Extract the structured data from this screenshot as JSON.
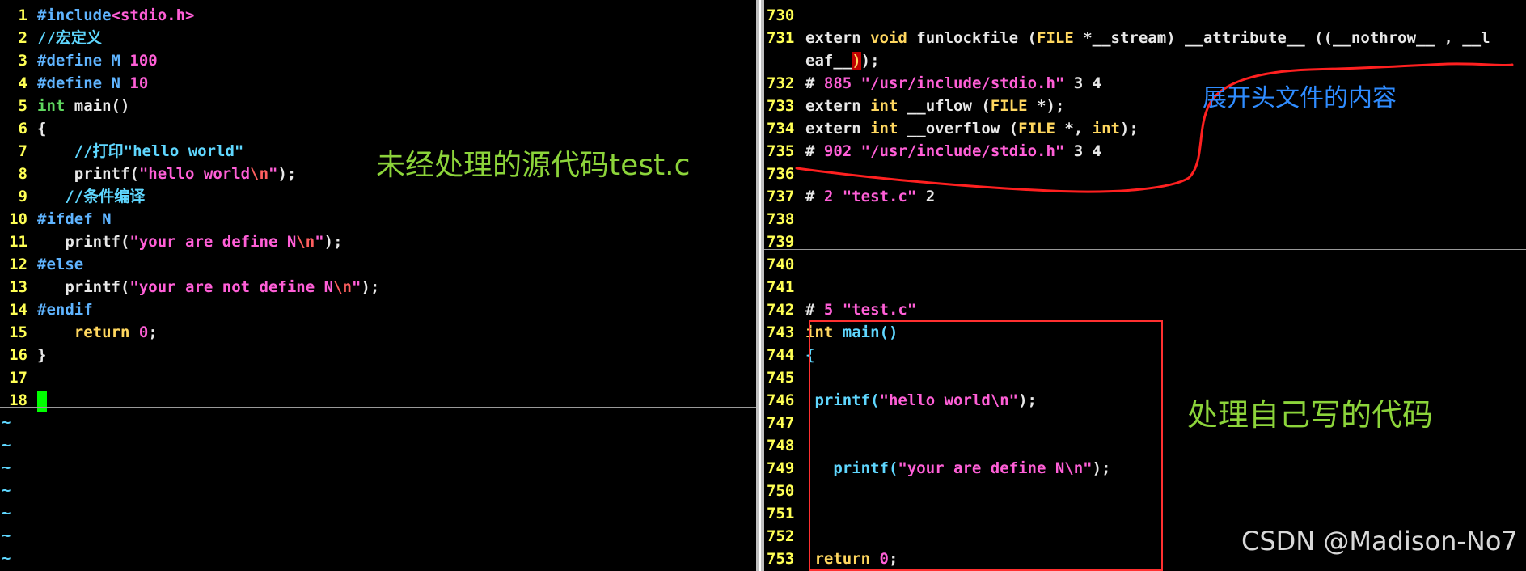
{
  "left_editor": {
    "lines": [
      {
        "n": "1",
        "parts": [
          {
            "t": "#include",
            "c": "t-pp"
          },
          {
            "t": "<stdio.h>",
            "c": "t-inc"
          }
        ]
      },
      {
        "n": "2",
        "parts": [
          {
            "t": "//宏定义",
            "c": "t-cm"
          }
        ]
      },
      {
        "n": "3",
        "parts": [
          {
            "t": "#define M ",
            "c": "t-pp"
          },
          {
            "t": "100",
            "c": "t-num"
          }
        ]
      },
      {
        "n": "4",
        "parts": [
          {
            "t": "#define N ",
            "c": "t-pp"
          },
          {
            "t": "10",
            "c": "t-num"
          }
        ]
      },
      {
        "n": "5",
        "parts": [
          {
            "t": "int",
            "c": "t-kw2"
          },
          {
            "t": " main()",
            "c": "t-plain"
          }
        ]
      },
      {
        "n": "6",
        "parts": [
          {
            "t": "{",
            "c": "t-plain"
          }
        ]
      },
      {
        "n": "7",
        "parts": [
          {
            "t": "    //打印\"hello world\"",
            "c": "t-cm"
          }
        ]
      },
      {
        "n": "8",
        "parts": [
          {
            "t": "    printf(",
            "c": "t-plain"
          },
          {
            "t": "\"hello world",
            "c": "t-str"
          },
          {
            "t": "\\n",
            "c": "t-esc"
          },
          {
            "t": "\"",
            "c": "t-str"
          },
          {
            "t": ");",
            "c": "t-plain"
          }
        ]
      },
      {
        "n": "9",
        "parts": [
          {
            "t": "   //条件编译",
            "c": "t-cm"
          }
        ]
      },
      {
        "n": "10",
        "parts": [
          {
            "t": "#ifdef N",
            "c": "t-pp"
          }
        ]
      },
      {
        "n": "11",
        "parts": [
          {
            "t": "   printf(",
            "c": "t-plain"
          },
          {
            "t": "\"your are define N",
            "c": "t-str"
          },
          {
            "t": "\\n",
            "c": "t-esc"
          },
          {
            "t": "\"",
            "c": "t-str"
          },
          {
            "t": ");",
            "c": "t-plain"
          }
        ]
      },
      {
        "n": "12",
        "parts": [
          {
            "t": "#else",
            "c": "t-pp"
          }
        ]
      },
      {
        "n": "13",
        "parts": [
          {
            "t": "   printf(",
            "c": "t-plain"
          },
          {
            "t": "\"your are not define N",
            "c": "t-str"
          },
          {
            "t": "\\n",
            "c": "t-esc"
          },
          {
            "t": "\"",
            "c": "t-str"
          },
          {
            "t": ");",
            "c": "t-plain"
          }
        ]
      },
      {
        "n": "14",
        "parts": [
          {
            "t": "#endif",
            "c": "t-pp"
          }
        ]
      },
      {
        "n": "15",
        "parts": [
          {
            "t": "    ",
            "c": "t-plain"
          },
          {
            "t": "return",
            "c": "t-kw"
          },
          {
            "t": " ",
            "c": "t-plain"
          },
          {
            "t": "0",
            "c": "t-num"
          },
          {
            "t": ";",
            "c": "t-plain"
          }
        ]
      },
      {
        "n": "16",
        "parts": [
          {
            "t": "}",
            "c": "t-plain"
          }
        ]
      },
      {
        "n": "17",
        "parts": []
      },
      {
        "n": "18",
        "parts": [],
        "cursor": true
      }
    ],
    "tilde": "~"
  },
  "right_editor": {
    "lines": [
      {
        "n": "730",
        "parts": []
      },
      {
        "n": "731",
        "parts": [
          {
            "t": "extern ",
            "c": "t-plain"
          },
          {
            "t": "void",
            "c": "t-kw"
          },
          {
            "t": " funlockfile (",
            "c": "t-plain"
          },
          {
            "t": "FILE",
            "c": "t-kw"
          },
          {
            "t": " *__stream) __attribute__ ((__nothrow__ , __l",
            "c": "t-plain"
          }
        ]
      },
      {
        "n": "",
        "parts": [
          {
            "t": "eaf__",
            "c": "t-plain"
          },
          {
            "t": ")",
            "c": "hl-red"
          },
          {
            "t": ");",
            "c": "t-plain"
          }
        ]
      },
      {
        "n": "732",
        "parts": [
          {
            "t": "# ",
            "c": "t-plain"
          },
          {
            "t": "885",
            "c": "t-num"
          },
          {
            "t": " ",
            "c": "t-plain"
          },
          {
            "t": "\"/usr/include/stdio.h\"",
            "c": "t-str"
          },
          {
            "t": " 3 4",
            "c": "t-plain"
          }
        ]
      },
      {
        "n": "733",
        "parts": [
          {
            "t": "extern ",
            "c": "t-plain"
          },
          {
            "t": "int",
            "c": "t-kw"
          },
          {
            "t": " __uflow (",
            "c": "t-plain"
          },
          {
            "t": "FILE",
            "c": "t-kw"
          },
          {
            "t": " *);",
            "c": "t-plain"
          }
        ]
      },
      {
        "n": "734",
        "parts": [
          {
            "t": "extern ",
            "c": "t-plain"
          },
          {
            "t": "int",
            "c": "t-kw"
          },
          {
            "t": " __overflow (",
            "c": "t-plain"
          },
          {
            "t": "FILE",
            "c": "t-kw"
          },
          {
            "t": " *, ",
            "c": "t-plain"
          },
          {
            "t": "int",
            "c": "t-kw"
          },
          {
            "t": ");",
            "c": "t-plain"
          }
        ]
      },
      {
        "n": "735",
        "parts": [
          {
            "t": "# ",
            "c": "t-plain"
          },
          {
            "t": "902",
            "c": "t-num"
          },
          {
            "t": " ",
            "c": "t-plain"
          },
          {
            "t": "\"/usr/include/stdio.h\"",
            "c": "t-str"
          },
          {
            "t": " 3 4",
            "c": "t-plain"
          }
        ]
      },
      {
        "n": "736",
        "parts": []
      },
      {
        "n": "737",
        "parts": [
          {
            "t": "# ",
            "c": "t-plain"
          },
          {
            "t": "2",
            "c": "t-num"
          },
          {
            "t": " ",
            "c": "t-plain"
          },
          {
            "t": "\"test.c\"",
            "c": "t-str"
          },
          {
            "t": " 2",
            "c": "t-plain"
          }
        ]
      },
      {
        "n": "738",
        "parts": []
      },
      {
        "n": "739",
        "parts": []
      },
      {
        "n": "740",
        "parts": []
      },
      {
        "n": "741",
        "parts": []
      },
      {
        "n": "742",
        "parts": [
          {
            "t": "# ",
            "c": "t-plain"
          },
          {
            "t": "5",
            "c": "t-num"
          },
          {
            "t": " ",
            "c": "t-plain"
          },
          {
            "t": "\"test.c\"",
            "c": "t-str"
          }
        ]
      },
      {
        "n": "743",
        "parts": [
          {
            "t": "int",
            "c": "t-kw"
          },
          {
            "t": " main()",
            "c": "t-fn"
          }
        ]
      },
      {
        "n": "744",
        "parts": [
          {
            "t": "{",
            "c": "t-fn"
          }
        ]
      },
      {
        "n": "745",
        "parts": []
      },
      {
        "n": "746",
        "parts": [
          {
            "t": " printf(",
            "c": "t-fn"
          },
          {
            "t": "\"hello world\\n\"",
            "c": "t-str"
          },
          {
            "t": ");",
            "c": "t-plain"
          }
        ]
      },
      {
        "n": "747",
        "parts": []
      },
      {
        "n": "748",
        "parts": []
      },
      {
        "n": "749",
        "parts": [
          {
            "t": "   printf(",
            "c": "t-fn"
          },
          {
            "t": "\"your are define N\\n\"",
            "c": "t-str"
          },
          {
            "t": ");",
            "c": "t-plain"
          }
        ]
      },
      {
        "n": "750",
        "parts": []
      },
      {
        "n": "751",
        "parts": []
      },
      {
        "n": "752",
        "parts": []
      },
      {
        "n": "753",
        "parts": [
          {
            "t": " ",
            "c": "t-plain"
          },
          {
            "t": "return",
            "c": "t-kw"
          },
          {
            "t": " ",
            "c": "t-plain"
          },
          {
            "t": "0",
            "c": "t-num"
          },
          {
            "t": ";",
            "c": "t-plain"
          }
        ]
      }
    ]
  },
  "annotations": {
    "left": "未经处理的源代码test.c",
    "right_top": "展开头文件的内容",
    "right_bottom": "处理自己写的代码",
    "watermark": "CSDN @Madison-No7"
  },
  "colors": {
    "annotation_green": "#8cd43a",
    "annotation_blue": "#2f8cff",
    "highlight_box": "#ff3030"
  }
}
